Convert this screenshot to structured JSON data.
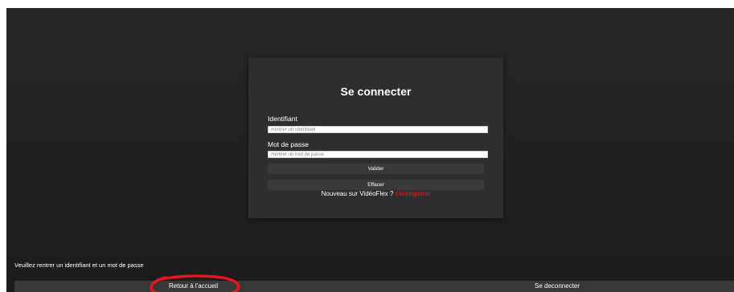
{
  "login": {
    "title": "Se connecter",
    "username_label": "Identifiant",
    "username_placeholder": "Rentrer un identifiant",
    "username_value": "",
    "password_label": "Mot de passe",
    "password_placeholder": "Rentrer un mot de passe",
    "password_value": "",
    "submit_label": "Valider",
    "clear_label": "Effacer",
    "register_prompt": "Nouveau sur VidéoFlex ?",
    "register_link": "s'enregistrer"
  },
  "status": {
    "message": "Veuillez rentrer un identifiant et un mot de passe"
  },
  "footer": {
    "home_link": "Retour à l'accueil",
    "logout_link": "Se deconnecter"
  },
  "colors": {
    "background": "#222222",
    "card": "#2e2e2e",
    "button": "#3a3a3a",
    "accent": "#e21b1b",
    "annotation": "#e8141b"
  }
}
